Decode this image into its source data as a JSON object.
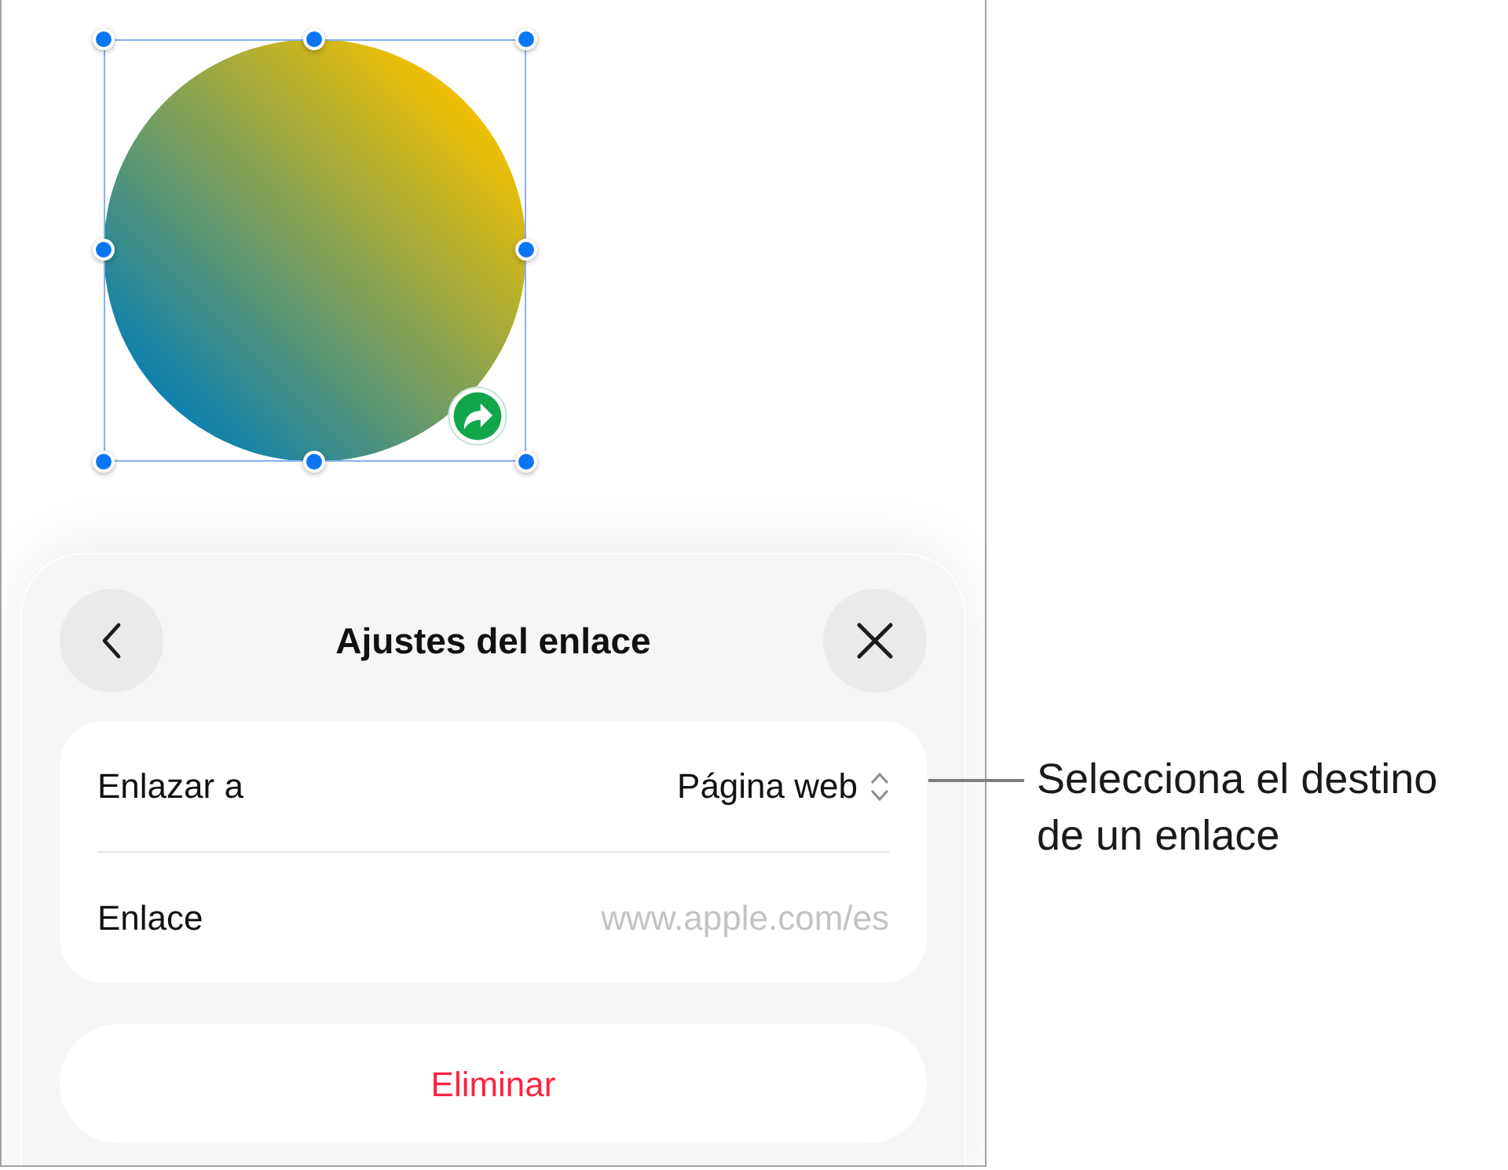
{
  "canvas": {
    "shape": {
      "selected": true,
      "linked": true
    }
  },
  "sheet": {
    "title": "Ajustes del enlace",
    "rows": [
      {
        "kind": "picker",
        "label": "Enlazar a",
        "value": "Página web"
      },
      {
        "kind": "field",
        "label": "Enlace",
        "placeholder": "www.apple.com/es"
      }
    ],
    "delete_button": "Eliminar"
  },
  "callouts": [
    {
      "lines": [
        "Selecciona el destino",
        "de un enlace"
      ]
    }
  ]
}
